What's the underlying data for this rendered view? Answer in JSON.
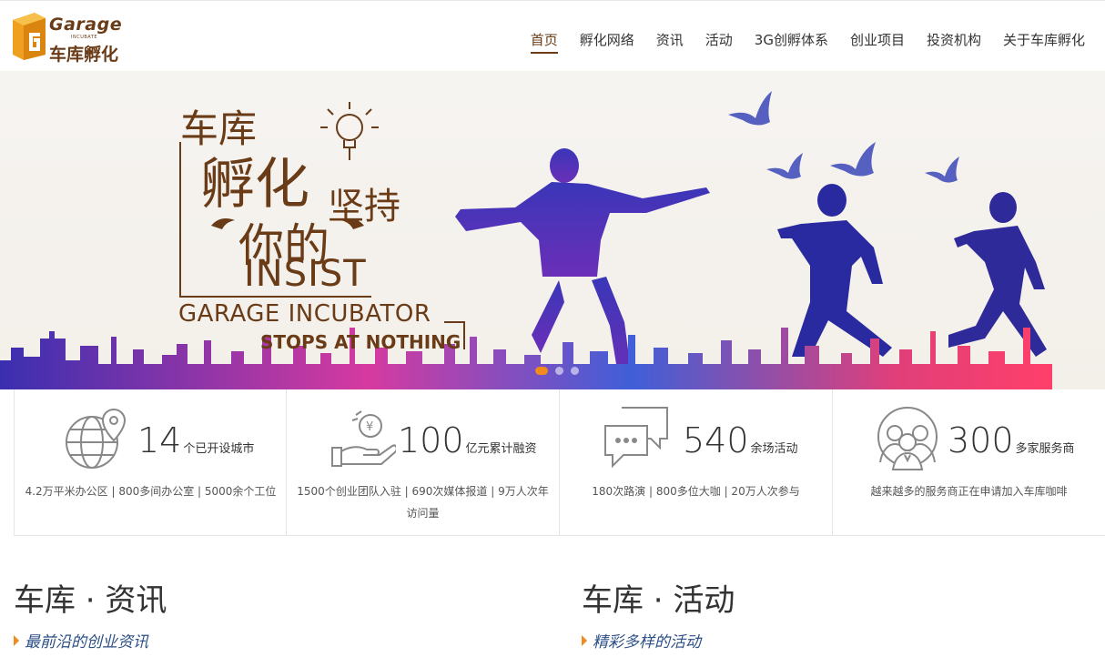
{
  "header": {
    "logo": {
      "en": "Garage",
      "sub": "INCUBATE",
      "cn": "车库孵化",
      "icon": "garage-g-logo"
    },
    "nav": [
      {
        "label": "首页",
        "active": true
      },
      {
        "label": "孵化网络",
        "active": false
      },
      {
        "label": "资讯",
        "active": false
      },
      {
        "label": "活动",
        "active": false
      },
      {
        "label": "3G创孵体系",
        "active": false
      },
      {
        "label": "创业项目",
        "active": false
      },
      {
        "label": "投资机构",
        "active": false
      },
      {
        "label": "关于车库孵化",
        "active": false
      }
    ]
  },
  "banner": {
    "line1": "车库",
    "line2": "孵化",
    "line3": "坚持",
    "line4": "你的",
    "insist": "INSIST",
    "garage": "GARAGE INCUBATOR",
    "stops": "STOPS AT NOTHING",
    "slides": 3,
    "active_slide": 1
  },
  "stats": [
    {
      "icon": "globe-location-icon",
      "number": "14",
      "unit": "个已开设城市",
      "desc": "4.2万平米办公区 | 800多间办公室 | 5000余个工位"
    },
    {
      "icon": "money-hand-icon",
      "number": "100",
      "unit": "亿元累计融资",
      "desc": "1500个创业团队入驻 | 690次媒体报道 | 9万人次年访问量"
    },
    {
      "icon": "chat-bubbles-icon",
      "number": "540",
      "unit": "余场活动",
      "desc": "180次路演 | 800多位大咖 | 20万人次参与"
    },
    {
      "icon": "people-group-icon",
      "number": "300",
      "unit": "多家服务商",
      "desc": "越来越多的服务商正在申请加入车库咖啡"
    }
  ],
  "sections": [
    {
      "title": "车库 · 资讯",
      "sub": "最前沿的创业资讯"
    },
    {
      "title": "车库 · 活动",
      "sub": "精彩多样的活动"
    }
  ],
  "colors": {
    "brand": "#6a3b17",
    "accent": "#f08a1c",
    "link": "#2b4f86"
  }
}
